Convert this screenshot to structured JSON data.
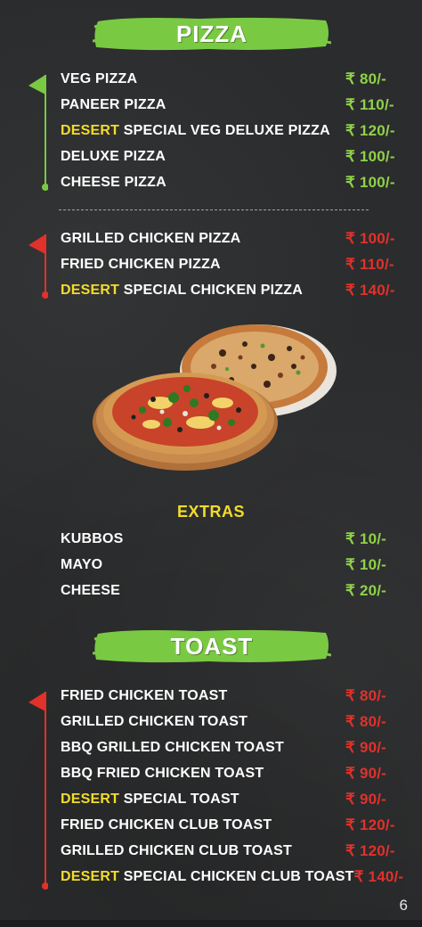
{
  "pizza": {
    "title": "PIZZA",
    "veg_items": [
      {
        "name": "VEG PIZZA",
        "highlight": "",
        "price": "₹ 80/-"
      },
      {
        "name": "PANEER PIZZA",
        "highlight": "",
        "price": "₹ 110/-"
      },
      {
        "name": " SPECIAL VEG DELUXE PIZZA",
        "highlight": "DESERT",
        "price": "₹ 120/-"
      },
      {
        "name": "DELUXE PIZZA",
        "highlight": "",
        "price": "₹ 100/-"
      },
      {
        "name": "CHEESE PIZZA",
        "highlight": "",
        "price": "₹ 100/-"
      }
    ],
    "nonveg_items": [
      {
        "name": "GRILLED CHICKEN PIZZA",
        "highlight": "",
        "price": "₹ 100/-"
      },
      {
        "name": "FRIED CHICKEN PIZZA",
        "highlight": "",
        "price": "₹ 110/-"
      },
      {
        "name": " SPECIAL CHICKEN PIZZA",
        "highlight": "DESERT",
        "price": "₹ 140/-"
      }
    ]
  },
  "extras": {
    "title": "EXTRAS",
    "items": [
      {
        "name": "KUBBOS",
        "price": "₹ 10/-"
      },
      {
        "name": "MAYO",
        "price": "₹ 10/-"
      },
      {
        "name": "CHEESE",
        "price": "₹ 20/-"
      }
    ]
  },
  "toast": {
    "title": "TOAST",
    "items": [
      {
        "name": "FRIED CHICKEN TOAST",
        "highlight": "",
        "price": "₹ 80/-"
      },
      {
        "name": "GRILLED CHICKEN TOAST",
        "highlight": "",
        "price": "₹ 80/-"
      },
      {
        "name": "BBQ GRILLED CHICKEN TOAST",
        "highlight": "",
        "price": "₹ 90/-"
      },
      {
        "name": "BBQ FRIED CHICKEN TOAST",
        "highlight": "",
        "price": "₹ 90/-"
      },
      {
        "name": " SPECIAL TOAST",
        "highlight": "DESERT",
        "price": "₹ 90/-"
      },
      {
        "name": "FRIED CHICKEN CLUB TOAST",
        "highlight": "",
        "price": "₹ 120/-"
      },
      {
        "name": "GRILLED CHICKEN CLUB TOAST",
        "highlight": "",
        "price": "₹ 120/-"
      },
      {
        "name": " SPECIAL CHICKEN CLUB TOAST",
        "highlight": "DESERT",
        "price": "₹ 140/-"
      }
    ]
  },
  "page_number": "6",
  "colors": {
    "banner_green": "#7ac943",
    "veg_price": "#8fd14a",
    "nonveg_price": "#e0312b",
    "highlight_yellow": "#f3dc2b",
    "background": "#2b2c2d"
  },
  "icons": {
    "veg_flag": "green-flag-icon",
    "nonveg_flag": "red-flag-icon",
    "food_image": "pizza-image"
  }
}
